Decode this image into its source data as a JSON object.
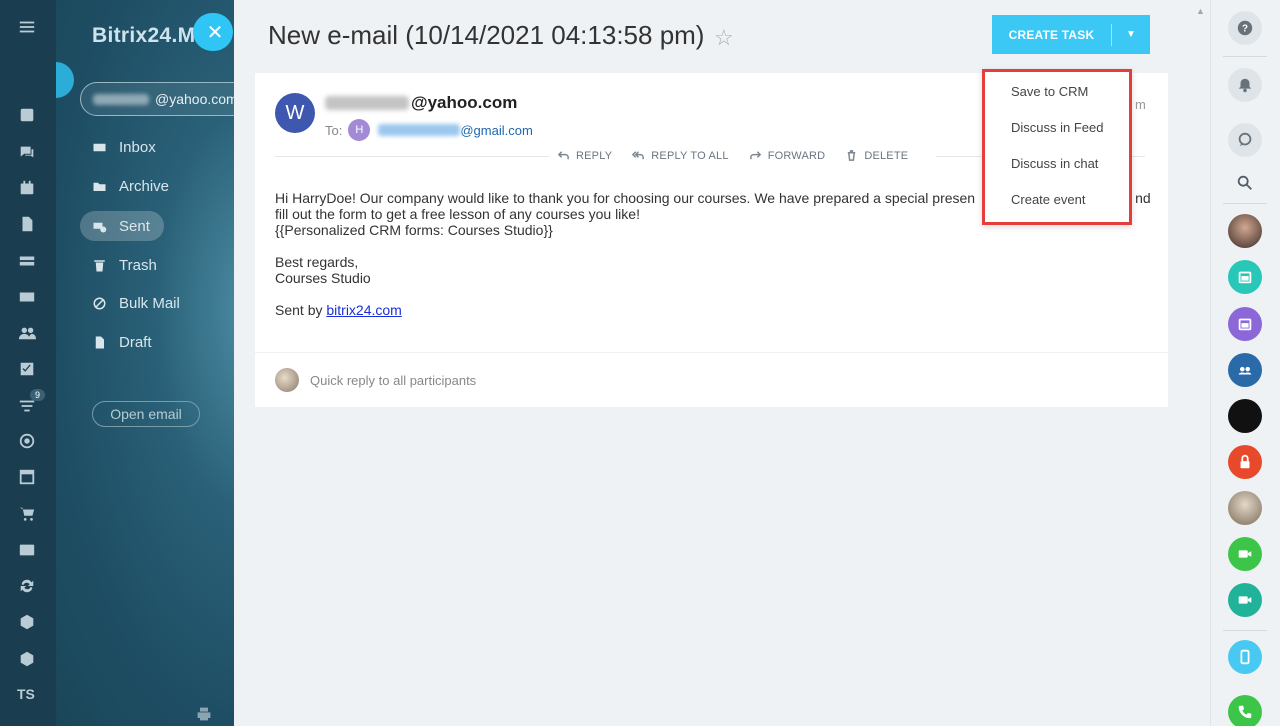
{
  "app": {
    "brand": "Bitrix24.M",
    "account_suffix": "@yahoo.com"
  },
  "sidebar": {
    "folders": [
      {
        "label": "Inbox",
        "icon": "inbox-icon"
      },
      {
        "label": "Archive",
        "icon": "folder-icon"
      },
      {
        "label": "Sent",
        "icon": "sent-icon",
        "active": true
      },
      {
        "label": "Trash",
        "icon": "trash-icon"
      },
      {
        "label": "Bulk Mail",
        "icon": "block-icon"
      },
      {
        "label": "Draft",
        "icon": "draft-icon"
      }
    ],
    "open_email": "Open email"
  },
  "left_rail": {
    "badge": "9",
    "ts_label": "TS"
  },
  "header": {
    "title": "New e-mail (10/14/2021 04:13:58 pm)",
    "create_task": "CREATE TASK"
  },
  "email": {
    "avatar_letter": "W",
    "from_suffix": "@yahoo.com",
    "to_label": "To:",
    "to_avatar_letter": "H",
    "to_suffix": "@gmail.com",
    "date_fragment": "m",
    "actions": [
      "REPLY",
      "REPLY TO ALL",
      "FORWARD",
      "DELETE"
    ],
    "body_line1": "Hi HarryDoe! Our company would like to thank you for choosing our courses. We have prepared a special  presen",
    "body_line1_tail": "nd",
    "body_line2": "fill out the form to get a free lesson of any courses you like!",
    "body_line3": "{{Personalized CRM forms: Courses Studio}}",
    "signoff1": "Best regards,",
    "signoff2": "Courses Studio",
    "sent_by": "Sent by ",
    "sent_link": "bitrix24.com",
    "quick_reply": "Quick reply to all participants"
  },
  "dropdown": {
    "items": [
      "Save to CRM",
      "Discuss in Feed",
      "Discuss in chat",
      "Create event"
    ],
    "highlight_color": "#e53c3c"
  },
  "colors": {
    "accent": "#3bc8f5",
    "link": "#1a2fd9",
    "avatar_w": "#3e58b0",
    "avatar_h": "#a38ad6"
  }
}
